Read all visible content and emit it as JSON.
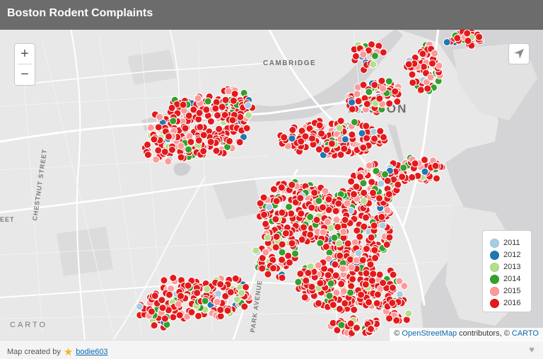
{
  "title": "Boston Rodent Complaints",
  "map_labels": {
    "cambridge": "CAMBRIDGE",
    "boston": "BOSTON",
    "chestnut_street": "CHESTNUT STREET",
    "street_partial": "EET",
    "park_avenue": "PARK AVENUE"
  },
  "zoom": {
    "in_label": "+",
    "out_label": "−"
  },
  "legend": {
    "items": [
      {
        "label": "2011",
        "color": "#a6cee3"
      },
      {
        "label": "2012",
        "color": "#1f78b4"
      },
      {
        "label": "2013",
        "color": "#b2df8a"
      },
      {
        "label": "2014",
        "color": "#33a02c"
      },
      {
        "label": "2015",
        "color": "#fb9a99"
      },
      {
        "label": "2016",
        "color": "#e31a1c"
      }
    ]
  },
  "carto_logo": "CARTO",
  "attribution": {
    "prefix": "©",
    "osm_link": "OpenStreetMap",
    "middle": "contributors, ©",
    "carto_link": "CARTO"
  },
  "footer": {
    "created_by": "Map created by",
    "author": "bodie603",
    "heart": "♥"
  },
  "colors": {
    "land": "#e8e8e8",
    "water": "#d4d4d6",
    "road": "#ffffff",
    "park": "#dcdcdc",
    "marker_stroke": "#ffffff"
  },
  "icons": [
    "locate-arrow-icon",
    "star-icon",
    "heart-icon"
  ]
}
